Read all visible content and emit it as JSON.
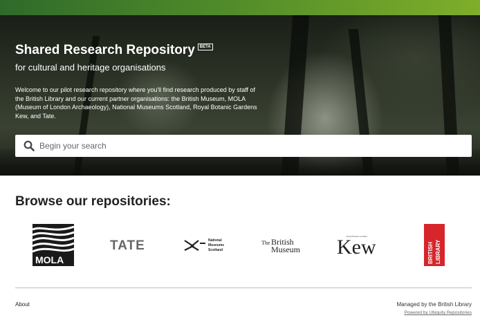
{
  "hero": {
    "title": "Shared Research Repository",
    "beta_badge": "BETA",
    "subtitle": "for cultural and heritage organisations",
    "description": "Welcome to our pilot research repository where you'll find research produced by staff of the British Library and our current partner organisations: the British Museum, MOLA (Museum of London Archaeology), National Museums Scotland, Royal Botanic Gardens Kew, and Tate."
  },
  "search": {
    "placeholder": "Begin your search",
    "value": "",
    "icon": "search-icon"
  },
  "browse": {
    "heading": "Browse our repositories:",
    "repositories": [
      {
        "logo_text": "MOLA",
        "icon": "mola-logo"
      },
      {
        "logo_text": "TATE",
        "icon": "tate-logo"
      },
      {
        "logo_text": [
          "National",
          "Museums",
          "Scotland"
        ],
        "icon": "national-museums-scotland-logo"
      },
      {
        "logo_text": [
          "The",
          "British",
          "Museum"
        ],
        "icon": "british-museum-logo"
      },
      {
        "logo_text": "Kew",
        "logo_subtext": "Royal Botanic Gardens",
        "icon": "kew-logo"
      },
      {
        "logo_text": [
          "BRITISH",
          "LIBRARY"
        ],
        "icon": "british-library-logo"
      }
    ]
  },
  "footer": {
    "about_label": "About",
    "managed_by": "Managed by the British Library",
    "powered_by": "Powered by Ubiquity Repositories"
  },
  "colors": {
    "top_bar_start": "#2f6a2b",
    "top_bar_end": "#7fae2a",
    "british_library_red": "#d6262b"
  }
}
